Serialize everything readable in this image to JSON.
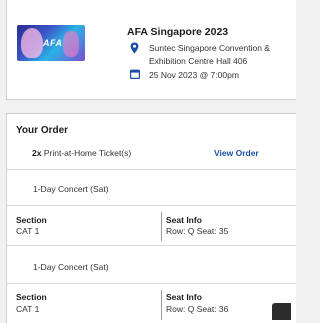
{
  "event": {
    "title": "AFA Singapore 2023",
    "venue": "Suntec Singapore Convention & Exhibition Centre Hall 406",
    "datetime": "25 Nov 2023 @ 7:00pm",
    "thumbnail_text": "AFA",
    "accent": "#1a4fa8"
  },
  "order": {
    "heading": "Your Order",
    "qty": "2x",
    "ticket_type": "Print-at-Home Ticket(s)",
    "view_order_label": "View Order",
    "tickets": [
      {
        "category": "1-Day Concert (Sat)",
        "section_label": "Section",
        "section": "CAT 1",
        "seat_label": "Seat Info",
        "seat": "Row: Q Seat: 35"
      },
      {
        "category": "1-Day Concert (Sat)",
        "section_label": "Section",
        "section": "CAT 1",
        "seat_label": "Seat Info",
        "seat": "Row: Q Seat: 36"
      }
    ]
  },
  "icons": {
    "venue": "location-pin-icon",
    "date": "calendar-icon"
  }
}
